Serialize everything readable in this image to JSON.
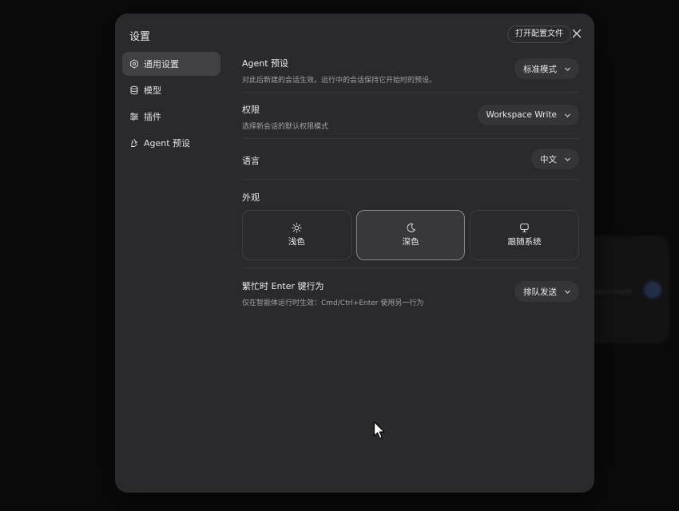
{
  "dialog": {
    "title": "设置",
    "open_config_label": "打开配置文件",
    "close_icon": "close-icon"
  },
  "sidebar": {
    "items": [
      {
        "label": "通用设置",
        "icon": "settings-hex-icon",
        "active": true
      },
      {
        "label": "模型",
        "icon": "database-icon",
        "active": false
      },
      {
        "label": "插件",
        "icon": "sliders-icon",
        "active": false
      },
      {
        "label": "Agent 预设",
        "icon": "recycle-icon",
        "active": false
      }
    ]
  },
  "settings": {
    "agent_preset": {
      "title": "Agent 预设",
      "desc": "对此后新建的会话生效。运行中的会话保持它开始时的预设。",
      "value": "标准模式"
    },
    "permission": {
      "title": "权限",
      "desc": "选择新会话的默认权限模式",
      "value": "Workspace Write"
    },
    "language": {
      "title": "语言",
      "value": "中文"
    },
    "appearance": {
      "title": "外观",
      "options": [
        {
          "label": "浅色",
          "icon": "sun-icon",
          "selected": false
        },
        {
          "label": "深色",
          "icon": "moon-icon",
          "selected": true
        },
        {
          "label": "跟随系统",
          "icon": "monitor-icon",
          "selected": false
        }
      ]
    },
    "busy_enter": {
      "title": "繁忙时 Enter 键行为",
      "desc": "仅在智能体运行时生效：Cmd/Ctrl+Enter 使用另一行为",
      "value": "排队发送"
    }
  },
  "background": {
    "faint_text": "plan-mode"
  },
  "colors": {
    "dialog_bg": "#2a2a2d",
    "active_nav_bg": "#404045",
    "selected_border": "#86868c"
  }
}
